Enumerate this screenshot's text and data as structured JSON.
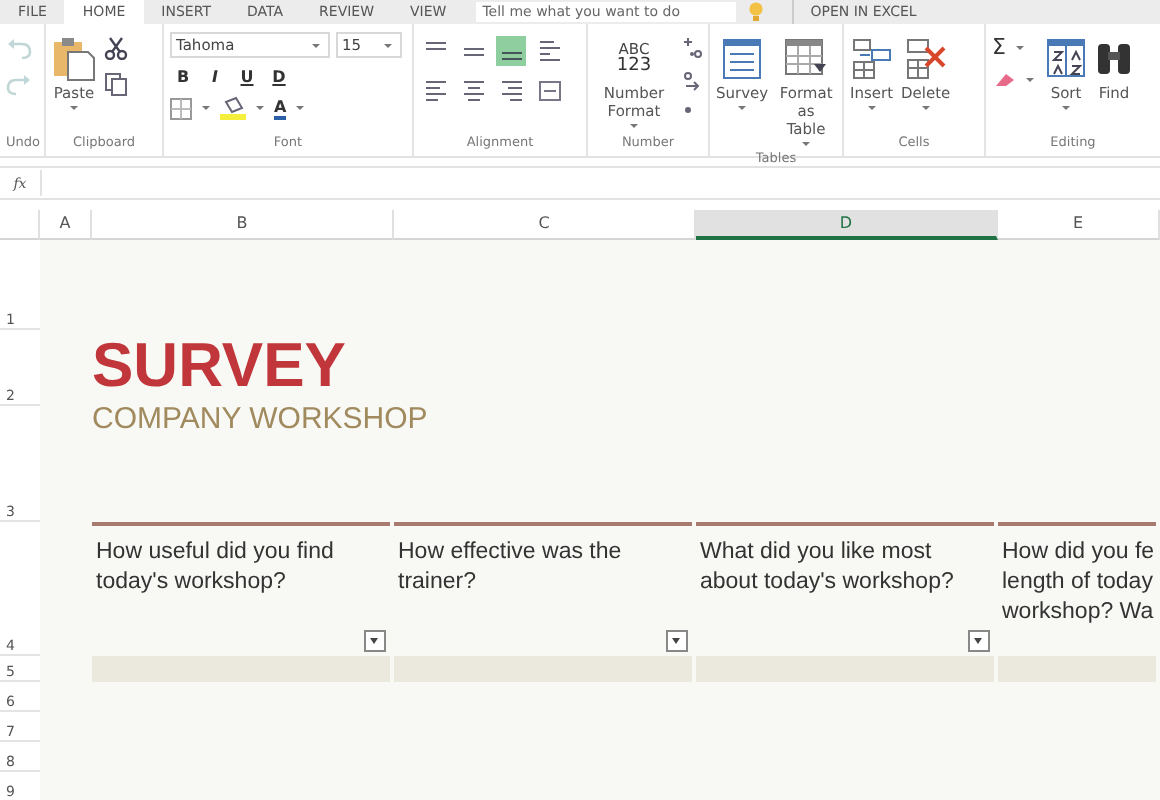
{
  "menu_tabs": [
    {
      "label": "FILE",
      "selected": false
    },
    {
      "label": "HOME",
      "selected": true
    },
    {
      "label": "INSERT",
      "selected": false
    },
    {
      "label": "DATA",
      "selected": false
    },
    {
      "label": "REVIEW",
      "selected": false
    },
    {
      "label": "VIEW",
      "selected": false
    }
  ],
  "search": {
    "placeholder": "Tell me what you want to do"
  },
  "open_in_excel": "OPEN IN EXCEL",
  "ribbon_groups": [
    {
      "kind": "undo",
      "label": "Undo",
      "disabled": true
    },
    {
      "kind": "clipboard",
      "label": "Clipboard",
      "buttons": [
        "Paste"
      ]
    },
    {
      "kind": "font",
      "label": "Font",
      "font": "Tahoma",
      "size": "15",
      "styles": [
        "B",
        "I",
        "U",
        "D"
      ],
      "font_color": "A"
    },
    {
      "kind": "alignment",
      "label": "Alignment",
      "options": [
        {
          "selected": false
        },
        {
          "selected": false
        },
        {
          "selected": true
        },
        {
          "selected": false
        },
        {
          "selected": false
        },
        {
          "selected": false
        },
        {
          "selected": false
        },
        {
          "selected": false
        }
      ]
    },
    {
      "kind": "number",
      "label": "Number",
      "icon_text": [
        "ABC",
        "123"
      ],
      "buttons": [
        "Number Format"
      ]
    },
    {
      "kind": "tables",
      "label": "Tables",
      "buttons": [
        "Survey",
        "Format as Table"
      ]
    },
    {
      "kind": "cells",
      "label": "Cells",
      "buttons": [
        "Insert",
        "Delete"
      ]
    },
    {
      "kind": "editing",
      "label": "Editing",
      "sum": "Σ",
      "buttons": [
        "Sort",
        "Find"
      ]
    }
  ],
  "formula_bar": {
    "label": "fx"
  },
  "columns": [
    {
      "label": "A",
      "selected": false
    },
    {
      "label": "B",
      "selected": false
    },
    {
      "label": "C",
      "selected": false
    },
    {
      "label": "D",
      "selected": true
    },
    {
      "label": "E",
      "selected": false
    }
  ],
  "row_numbers": [
    "1",
    "2",
    "3",
    "4",
    "5",
    "6",
    "7",
    "8",
    "9"
  ],
  "title": "SURVEY",
  "subtitle": "COMPANY WORKSHOP",
  "questions": [
    {
      "lines": [
        "How useful did you find",
        "today's workshop?"
      ],
      "filter": true
    },
    {
      "lines": [
        "How effective was the",
        "trainer?"
      ],
      "filter": true
    },
    {
      "lines": [
        "What did you like most",
        "about today's workshop?"
      ],
      "filter": true
    },
    {
      "lines": [
        "How did you fe",
        "length of today",
        "workshop? Wa"
      ],
      "filter": false
    }
  ]
}
